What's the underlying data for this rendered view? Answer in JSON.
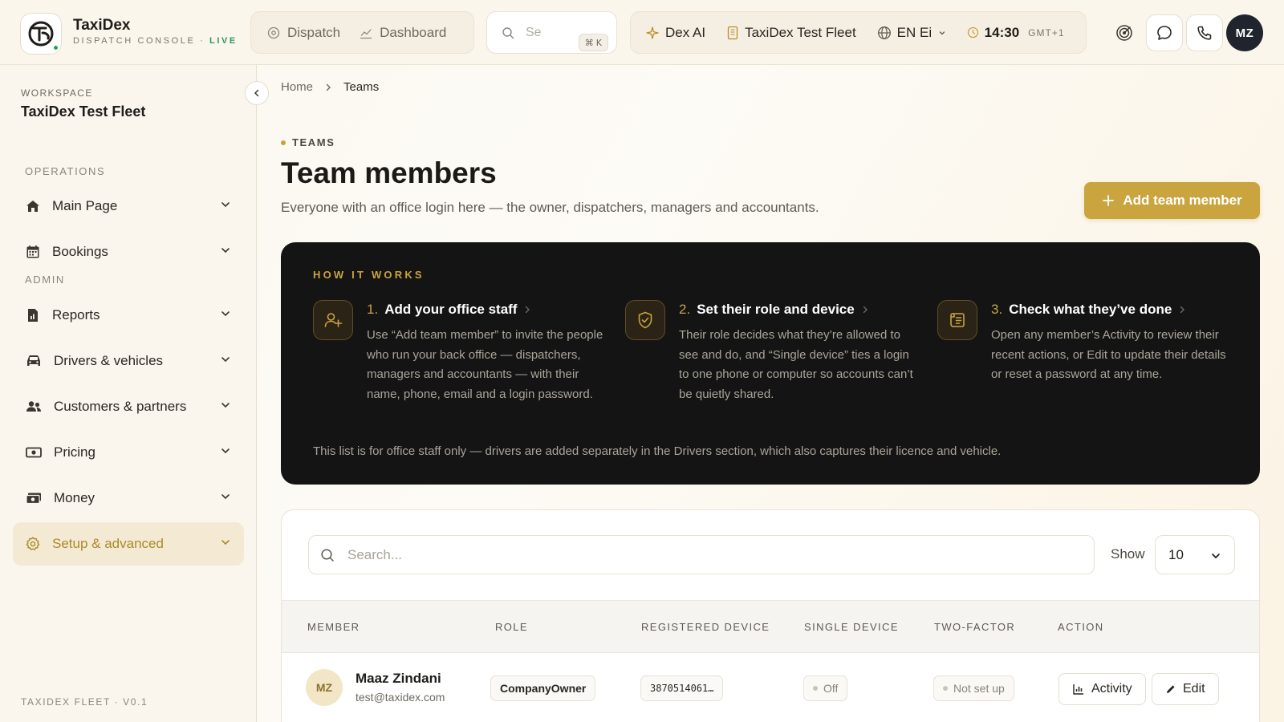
{
  "brand": {
    "name": "TaxiDex",
    "subtitle": "DISPATCH CONSOLE · ",
    "live": "LIVE"
  },
  "topnav": {
    "dispatch": "Dispatch",
    "dashboard": "Dashboard",
    "search_placeholder": "Se",
    "shortcut_symbol": "⌘",
    "shortcut_key": "K",
    "dex_ai": "Dex AI",
    "fleet": "TaxiDex Test Fleet",
    "language": "EN Ei",
    "time": "14:30",
    "timezone": "GMT+1",
    "avatar": "MZ"
  },
  "sidebar": {
    "workspace_label": "WORKSPACE",
    "workspace_name": "TaxiDex Test Fleet",
    "operations_label": "OPERATIONS",
    "admin_label": "ADMIN",
    "items": [
      {
        "label": "Main Page",
        "icon": "home-icon"
      },
      {
        "label": "Bookings",
        "icon": "calendar-icon"
      },
      {
        "label": "Reports",
        "icon": "report-icon"
      },
      {
        "label": "Drivers & vehicles",
        "icon": "car-icon"
      },
      {
        "label": "Customers & partners",
        "icon": "users-icon"
      },
      {
        "label": "Pricing",
        "icon": "price-icon"
      },
      {
        "label": "Money",
        "icon": "money-icon"
      },
      {
        "label": "Setup & advanced",
        "icon": "gear-icon",
        "active": true
      }
    ],
    "footer": "TAXIDEX FLEET · V0.1"
  },
  "breadcrumb": {
    "home": "Home",
    "current": "Teams"
  },
  "page": {
    "eyebrow": "TEAMS",
    "title": "Team members",
    "subtitle": "Everyone with an office login here — the owner, dispatchers, managers and accountants.",
    "add_button": "Add team member"
  },
  "how_it_works": {
    "label": "HOW IT WORKS",
    "steps": [
      {
        "num": "1.",
        "title": "Add your office staff",
        "body": "Use “Add team member” to invite the people who run your back office — dispatchers, managers and accountants — with their name, phone, email and a login password."
      },
      {
        "num": "2.",
        "title": "Set their role and device",
        "body": "Their role decides what they’re allowed to see and do, and “Single device” ties a login to one phone or computer so accounts can’t be quietly shared."
      },
      {
        "num": "3.",
        "title": "Check what they’ve done",
        "body": "Open any member’s Activity to review their recent actions, or Edit to update their details or reset a password at any time."
      }
    ],
    "note": "This list is for office staff only — drivers are added separately in the Drivers section, which also captures their licence and vehicle."
  },
  "table": {
    "search_placeholder": "Search...",
    "show_label": "Show",
    "show_value": "10",
    "columns": [
      "MEMBER",
      "ROLE",
      "REGISTERED DEVICE",
      "SINGLE DEVICE",
      "TWO-FACTOR",
      "ACTION"
    ],
    "rows": [
      {
        "initials": "MZ",
        "name": "Maaz Zindani",
        "email": "test@taxidex.com",
        "role": "CompanyOwner",
        "device": "3870514061…",
        "single_device": "Off",
        "two_factor": "Not set up",
        "activity": "Activity",
        "edit": "Edit"
      }
    ]
  },
  "colors": {
    "accent": "#c9a43f",
    "dark_panel": "#141414",
    "live": "#2f9a5d"
  }
}
